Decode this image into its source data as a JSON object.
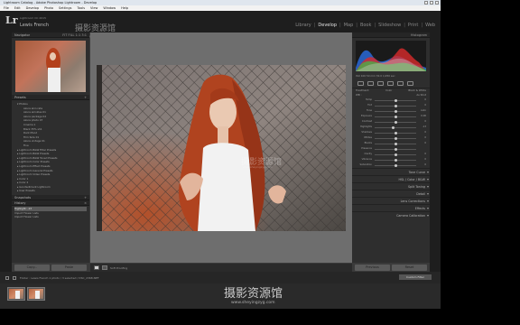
{
  "window": {
    "title": "Lightroom Catalog - Adobe Photoshop Lightroom - Develop"
  },
  "menu": [
    "File",
    "Edit",
    "Develop",
    "Photo",
    "Settings",
    "Tools",
    "View",
    "Window",
    "Help"
  ],
  "header": {
    "logo": "Lr",
    "catalog_line": "Lightroom CC 2015",
    "identity_name": "Lewis French",
    "watermark": "摄影资源馆",
    "watermark_sub": "www.sheyingzyg.com",
    "modules": [
      "Library",
      "Develop",
      "Map",
      "Book",
      "Slideshow",
      "Print",
      "Web"
    ],
    "active_module": "Develop"
  },
  "left": {
    "navigator": {
      "title": "Navigator",
      "zoom_options": "FIT  FILL  1:1  3:1"
    },
    "presets": {
      "title": "Presets",
      "items": [
        {
          "label": "▾ Photos",
          "kind": "folder"
        },
        {
          "label": "Azure skin rate",
          "kind": "sub"
        },
        {
          "label": "Azure wrinkles 01",
          "kind": "sub"
        },
        {
          "label": "Azure package 02",
          "kind": "sub"
        },
        {
          "label": "Azure photo 07",
          "kind": "sub"
        },
        {
          "label": "Cinema 1",
          "kind": "sub"
        },
        {
          "label": "Black 35% sh1",
          "kind": "sub"
        },
        {
          "label": "Dark Mood",
          "kind": "sub"
        },
        {
          "label": "Film fade 01",
          "kind": "sub"
        },
        {
          "label": "Azure vintage 01",
          "kind": "sub"
        },
        {
          "label": "Fine",
          "kind": "sub"
        },
        {
          "label": "▸ Lightroom B&W Filter Presets",
          "kind": "folder"
        },
        {
          "label": "▸ Lightroom B&W Presets",
          "kind": "folder"
        },
        {
          "label": "▸ Lightroom B&W Toned Presets",
          "kind": "folder"
        },
        {
          "label": "▸ Lightroom Color Presets",
          "kind": "folder"
        },
        {
          "label": "▸ Lightroom Effect Presets",
          "kind": "folder"
        },
        {
          "label": "▸ Lightroom General Presets",
          "kind": "folder"
        },
        {
          "label": "▸ Lightroom Video Presets",
          "kind": "folder"
        },
        {
          "label": "▸ Color 1",
          "kind": "folder"
        },
        {
          "label": "▸ Color 2",
          "kind": "folder"
        },
        {
          "label": "▸ Goodwillment Lightroom",
          "kind": "folder"
        },
        {
          "label": "▸ User Presets",
          "kind": "folder"
        }
      ]
    },
    "snapshots": {
      "title": "Snapshots"
    },
    "history": {
      "title": "History",
      "items": [
        "Highlight: -13",
        "Import Flower Lists",
        "Import Flower Lists"
      ],
      "selected_index": 0
    },
    "buttons": {
      "copy": "Copy...",
      "paste": "Paste"
    }
  },
  "toolbar": {
    "soft_proofing": "Soft Proofing"
  },
  "right": {
    "histogram": {
      "title": "Histogram",
      "info": "ISO 100   50 mm   f/2.0   1/250 sec",
      "original_photo": "Original Photo"
    },
    "basic": {
      "treatment_label": "Treatment:",
      "color": "Color",
      "bw": "Black & White",
      "wb_label": "WB :",
      "wb_value": "As Shot",
      "sliders": [
        {
          "name": "Temp",
          "value": "0",
          "pos": 0.5
        },
        {
          "name": "Tint",
          "value": "0",
          "pos": 0.5
        },
        {
          "name": "Tone",
          "value": "Auto",
          "pos": 0.5
        },
        {
          "name": "Exposure",
          "value": "0.00",
          "pos": 0.5
        },
        {
          "name": "Contrast",
          "value": "0",
          "pos": 0.5
        },
        {
          "name": "Highlights",
          "value": "-13",
          "pos": 0.44
        },
        {
          "name": "Shadows",
          "value": "0",
          "pos": 0.5
        },
        {
          "name": "Whites",
          "value": "0",
          "pos": 0.5
        },
        {
          "name": "Blacks",
          "value": "0",
          "pos": 0.5
        },
        {
          "name": "Presence",
          "value": "",
          "pos": 0.5
        },
        {
          "name": "Clarity",
          "value": "0",
          "pos": 0.5
        },
        {
          "name": "Vibrance",
          "value": "0",
          "pos": 0.5
        },
        {
          "name": "Saturation",
          "value": "0",
          "pos": 0.5
        }
      ]
    },
    "sections": [
      "Tone Curve",
      "HSL / Color / B&W",
      "Split Toning",
      "Detail",
      "Lens Corrections",
      "Effects",
      "Camera Calibration"
    ],
    "buttons": {
      "previous": "Previous",
      "reset": "Reset"
    }
  },
  "filmbar": {
    "info": "Folder : Lewis French   1 photo / 3 selected / DSC_2368.NEF",
    "filter_label": "Custom Filter"
  },
  "colors": {
    "accent": "#e4e4e4",
    "panel": "#2e2e2e",
    "canvas": "#6e6e6e",
    "hair": "#b3401c"
  }
}
